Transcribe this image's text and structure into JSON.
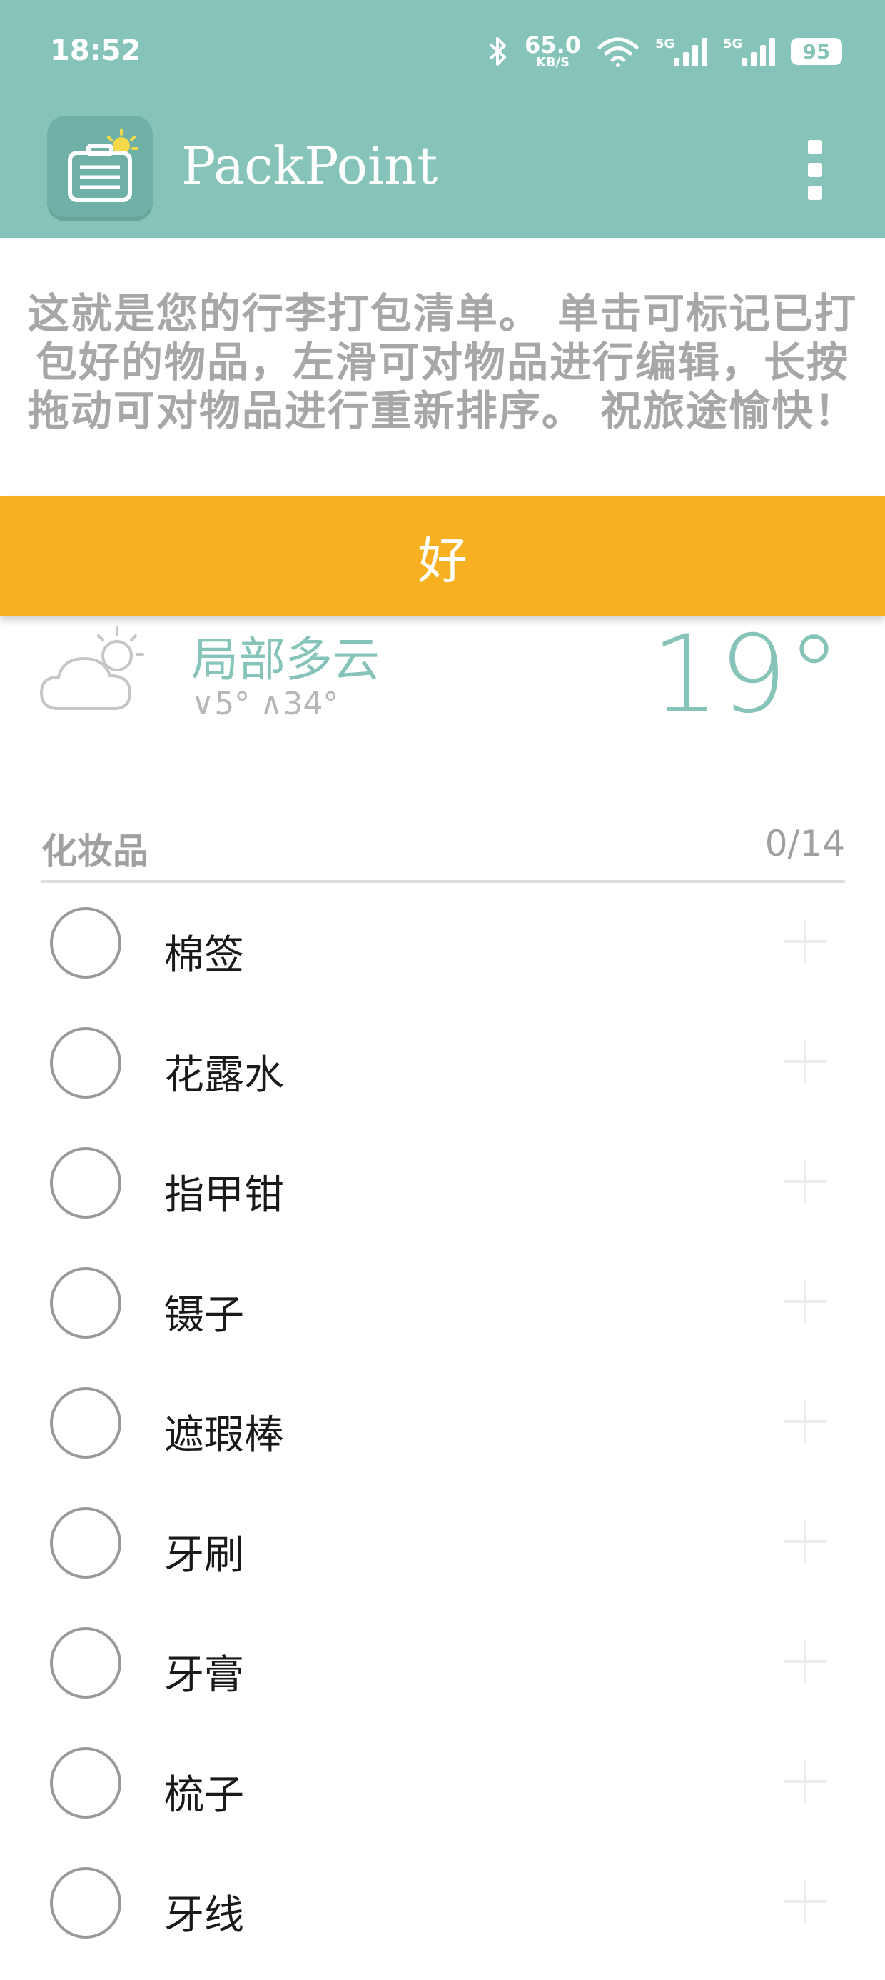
{
  "status_bar": {
    "time": "18:52",
    "net_speed": "65.0",
    "net_unit": "KB/S",
    "sim1_label": "5G",
    "sim2_label": "5G",
    "battery": "95"
  },
  "app_bar": {
    "title": "PackPoint",
    "icon": "suitcase-sun-icon",
    "menu_icon": "more-vert-icon"
  },
  "banner": {
    "lines": [
      "这就是您的行李打包清单。 单击可标记已打",
      "包好的物品，左滑可对物品进行编辑，长按",
      "拖动可对物品进行重新排序。 祝旅途愉快！"
    ],
    "ok_label": "好"
  },
  "weather": {
    "icon": "partly-cloudy-icon",
    "condition": "局部多云",
    "range": "∨5° ∧34°",
    "temperature": "19°"
  },
  "category": {
    "title": "化妆品",
    "count": "0/14",
    "items": [
      {
        "label": "棉签"
      },
      {
        "label": "花露水"
      },
      {
        "label": "指甲钳"
      },
      {
        "label": "镊子"
      },
      {
        "label": "遮瑕棒"
      },
      {
        "label": "牙刷"
      },
      {
        "label": "牙膏"
      },
      {
        "label": "梳子"
      },
      {
        "label": "牙线"
      }
    ]
  },
  "colors": {
    "primary": "#86c4b9",
    "accent": "#f7b022",
    "muted_text": "#a7a7a7"
  }
}
